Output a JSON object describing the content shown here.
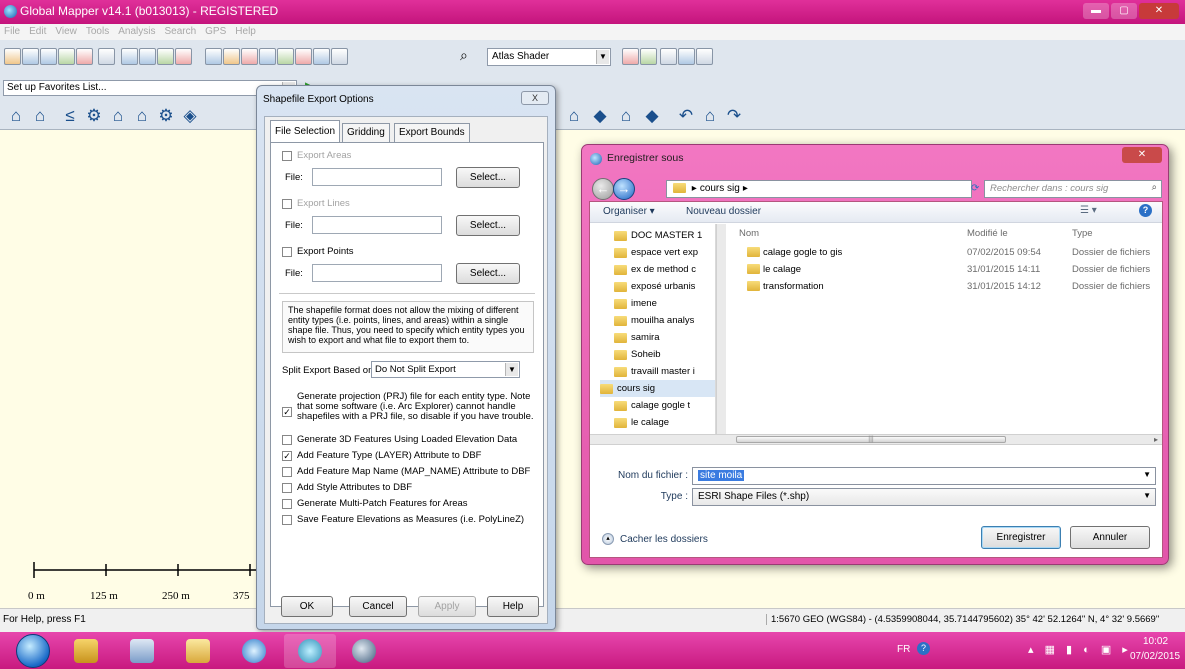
{
  "window": {
    "title": "Global Mapper v14.1 (b013013) - REGISTERED"
  },
  "menu": [
    "File",
    "Edit",
    "View",
    "Tools",
    "Analysis",
    "Search",
    "GPS",
    "Help"
  ],
  "toolbar": {
    "shader_label": "Atlas Shader",
    "favorites_placeholder": "Set up Favorites List..."
  },
  "scale": {
    "labels": [
      "0 m",
      "125 m",
      "250 m",
      "375"
    ]
  },
  "statusbar": {
    "help_text": "For Help, press F1",
    "coords": "1:5670  GEO (WGS84) - (4.5359908044, 35.7144795602)  35° 42' 52.1264\" N, 4° 32' 9.5669\""
  },
  "export_dialog": {
    "title": "Shapefile Export Options",
    "close_label": "X",
    "tabs": [
      "File Selection",
      "Gridding",
      "Export Bounds"
    ],
    "export_areas_label": "Export Areas",
    "export_lines_label": "Export Lines",
    "export_points_label": "Export Points",
    "file_label": "File:",
    "select_label": "Select...",
    "note": "The shapefile format does not allow the mixing of different entity types (i.e. points, lines, and areas) within a single shape file. Thus, you need to specify which entity types you wish to export and what file to export them to.",
    "split_label": "Split Export Based on:",
    "split_value": "Do Not Split Export",
    "options": [
      {
        "label": "Generate projection (PRJ) file for each entity type. Note that some software (i.e. Arc Explorer) cannot handle shapefiles with a PRJ file, so disable if you have trouble.",
        "checked": true
      },
      {
        "label": "Generate 3D Features Using Loaded Elevation Data",
        "checked": false
      },
      {
        "label": "Add Feature Type (LAYER) Attribute to DBF",
        "checked": true
      },
      {
        "label": "Add Feature Map Name (MAP_NAME) Attribute to DBF",
        "checked": false
      },
      {
        "label": "Add Style Attributes to DBF",
        "checked": false
      },
      {
        "label": "Generate Multi-Patch Features for Areas",
        "checked": false
      },
      {
        "label": "Save Feature Elevations as Measures (i.e. PolyLineZ)",
        "checked": false
      }
    ],
    "buttons": {
      "ok": "OK",
      "cancel": "Cancel",
      "apply": "Apply",
      "help": "Help"
    }
  },
  "save_dialog": {
    "title": "Enregistrer sous",
    "address": "cours sig",
    "search_placeholder": "Rechercher dans : cours sig",
    "organize_label": "Organiser ▾",
    "new_folder_label": "Nouveau dossier",
    "tree": [
      "DOC MASTER 1",
      "espace vert exp",
      "ex de method c",
      "exposé urbanis",
      "imene",
      "mouilha analys",
      "samira",
      "Soheib",
      "travaill master i",
      "cours sig",
      "calage gogle t",
      "le calage"
    ],
    "columns": {
      "name": "Nom",
      "modified": "Modifié le",
      "type": "Type"
    },
    "files": [
      {
        "name": "calage gogle  to gis",
        "modified": "07/02/2015 09:54",
        "type": "Dossier de fichiers"
      },
      {
        "name": "le calage",
        "modified": "31/01/2015 14:11",
        "type": "Dossier de fichiers"
      },
      {
        "name": "transformation",
        "modified": "31/01/2015 14:12",
        "type": "Dossier de fichiers"
      }
    ],
    "filename_label": "Nom du fichier :",
    "filename_value": "site moila",
    "type_label": "Type :",
    "type_value": "ESRI Shape Files (*.shp)",
    "hide_folders_label": "Cacher les dossiers",
    "save_button": "Enregistrer",
    "cancel_button": "Annuler"
  },
  "taskbar": {
    "lang": "FR",
    "time": "10:02",
    "date": "07/02/2015"
  }
}
